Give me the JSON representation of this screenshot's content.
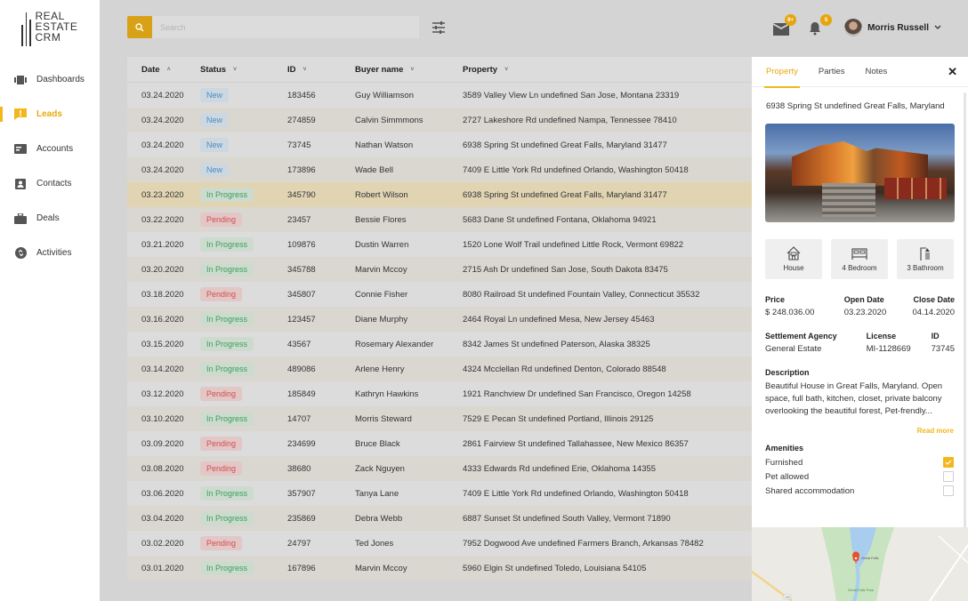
{
  "app": {
    "logo_lines": [
      "REAL",
      "ESTATE",
      "CRM"
    ]
  },
  "sidebar": {
    "items": [
      {
        "label": "Dashboards",
        "icon": "dashboard-icon",
        "active": false
      },
      {
        "label": "Leads",
        "icon": "leads-alert-icon",
        "active": true
      },
      {
        "label": "Accounts",
        "icon": "accounts-icon",
        "active": false
      },
      {
        "label": "Contacts",
        "icon": "contacts-icon",
        "active": false
      },
      {
        "label": "Deals",
        "icon": "briefcase-icon",
        "active": false
      },
      {
        "label": "Activities",
        "icon": "activities-icon",
        "active": false
      }
    ]
  },
  "topbar": {
    "search_placeholder": "Search",
    "search_value": "",
    "mail_badge": "9+",
    "notifications_badge": "5",
    "user_name": "Morris Russell"
  },
  "colors": {
    "accent": "#f3b71c",
    "new": "#4a8dc4",
    "in_progress": "#3aa05c",
    "pending": "#d0504f"
  },
  "table": {
    "columns": [
      {
        "label": "Date",
        "sort": "asc"
      },
      {
        "label": "Status",
        "sort": "desc"
      },
      {
        "label": "ID",
        "sort": "desc"
      },
      {
        "label": "Buyer name",
        "sort": "desc"
      },
      {
        "label": "Property",
        "sort": "desc"
      }
    ],
    "rows": [
      {
        "date": "03.24.2020",
        "status": "New",
        "id": "183456",
        "buyer": "Guy Williamson",
        "property": "3589 Valley View Ln undefined San Jose, Montana 23319"
      },
      {
        "date": "03.24.2020",
        "status": "New",
        "id": "274859",
        "buyer": "Calvin Simmmons",
        "property": "2727 Lakeshore Rd undefined Nampa, Tennessee 78410"
      },
      {
        "date": "03.24.2020",
        "status": "New",
        "id": "73745",
        "buyer": "Nathan Watson",
        "property": "6938 Spring St undefined Great Falls, Maryland 31477"
      },
      {
        "date": "03.24.2020",
        "status": "New",
        "id": "173896",
        "buyer": "Wade Bell",
        "property": "7409 E Little York Rd undefined Orlando, Washington 50418"
      },
      {
        "date": "03.23.2020",
        "status": "In Progress",
        "id": "345790",
        "buyer": "Robert Wilson",
        "property": "6938 Spring St undefined Great Falls, Maryland 31477",
        "selected": true
      },
      {
        "date": "03.22.2020",
        "status": "Pending",
        "id": "23457",
        "buyer": "Bessie Flores",
        "property": "5683 Dane St undefined Fontana, Oklahoma 94921"
      },
      {
        "date": "03.21.2020",
        "status": "In Progress",
        "id": "109876",
        "buyer": "Dustin Warren",
        "property": "1520 Lone Wolf Trail undefined Little Rock, Vermont 69822"
      },
      {
        "date": "03.20.2020",
        "status": "In Progress",
        "id": "345788",
        "buyer": "Marvin Mccoy",
        "property": "2715 Ash Dr undefined San Jose, South Dakota 83475"
      },
      {
        "date": "03.18.2020",
        "status": "Pending",
        "id": "345807",
        "buyer": "Connie Fisher",
        "property": "8080 Railroad St undefined Fountain Valley, Connecticut 35532"
      },
      {
        "date": "03.16.2020",
        "status": "In Progress",
        "id": "123457",
        "buyer": "Diane Murphy",
        "property": "2464 Royal Ln undefined Mesa, New Jersey 45463"
      },
      {
        "date": "03.15.2020",
        "status": "In Progress",
        "id": "43567",
        "buyer": "Rosemary Alexander",
        "property": "8342 James St undefined Paterson, Alaska 38325"
      },
      {
        "date": "03.14.2020",
        "status": "In Progress",
        "id": "489086",
        "buyer": "Arlene Henry",
        "property": "4324 Mcclellan Rd undefined Denton, Colorado 88548"
      },
      {
        "date": "03.12.2020",
        "status": "Pending",
        "id": "185849",
        "buyer": "Kathryn Hawkins",
        "property": "1921 Ranchview Dr undefined San Francisco, Oregon 14258"
      },
      {
        "date": "03.10.2020",
        "status": "In Progress",
        "id": "14707",
        "buyer": "Morris Steward",
        "property": "7529 E Pecan St undefined Portland, Illinois 29125"
      },
      {
        "date": "03.09.2020",
        "status": "Pending",
        "id": "234699",
        "buyer": "Bruce Black",
        "property": "2861 Fairview St undefined Tallahassee, New Mexico 86357"
      },
      {
        "date": "03.08.2020",
        "status": "Pending",
        "id": "38680",
        "buyer": "Zack Nguyen",
        "property": "4333 Edwards Rd undefined Erie, Oklahoma 14355"
      },
      {
        "date": "03.06.2020",
        "status": "In Progress",
        "id": "357907",
        "buyer": "Tanya Lane",
        "property": "7409 E Little York Rd undefined Orlando, Washington 50418"
      },
      {
        "date": "03.04.2020",
        "status": "In Progress",
        "id": "235869",
        "buyer": "Debra Webb",
        "property": "6887 Sunset St undefined South Valley, Vermont 71890"
      },
      {
        "date": "03.02.2020",
        "status": "Pending",
        "id": "24797",
        "buyer": "Ted Jones",
        "property": "7952 Dogwood Ave undefined Farmers Branch, Arkansas 78482"
      },
      {
        "date": "03.01.2020",
        "status": "In Progress",
        "id": "167896",
        "buyer": "Marvin Mccoy",
        "property": "5960 Elgin St undefined Toledo, Louisiana 54105"
      }
    ]
  },
  "panel": {
    "tabs": [
      {
        "label": "Property",
        "active": true
      },
      {
        "label": "Parties",
        "active": false
      },
      {
        "label": "Notes",
        "active": false
      }
    ],
    "close_label": "✕",
    "address": "6938 Spring St undefined Great Falls, Maryland",
    "features": [
      {
        "label": "House",
        "icon": "house-icon"
      },
      {
        "label": "4 Bedroom",
        "icon": "bed-icon"
      },
      {
        "label": "3 Bathroom",
        "icon": "shower-icon"
      }
    ],
    "price": {
      "label": "Price",
      "value": "$ 248.036.00"
    },
    "open_date": {
      "label": "Open Date",
      "value": "03.23.2020"
    },
    "close_date": {
      "label": "Close Date",
      "value": "04.14.2020"
    },
    "agency": {
      "label": "Settlement Agency",
      "value": "General Estate"
    },
    "license": {
      "label": "License",
      "value": "MI-1128669"
    },
    "id": {
      "label": "ID",
      "value": "73745"
    },
    "description_title": "Description",
    "description": "Beautiful House in Great Falls, Maryland. Open space, full bath, kitchen, closet, private balcony overlooking the beautiful forest, Pet-frendly...",
    "read_more": "Read more",
    "amenities_title": "Amenities",
    "amenities": [
      {
        "label": "Furnished",
        "checked": true
      },
      {
        "label": "Pet allowed",
        "checked": false
      },
      {
        "label": "Shared accommodation",
        "checked": false
      }
    ],
    "map": {
      "place_label": "Great Falls",
      "park_label": "Great Falls Park",
      "road_label": "193"
    }
  }
}
